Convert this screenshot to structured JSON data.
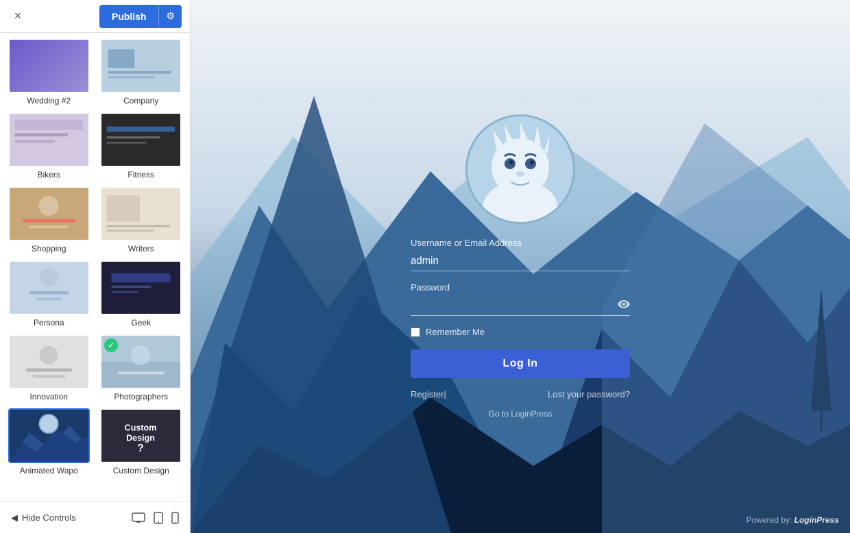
{
  "header": {
    "close_label": "×",
    "publish_label": "Publish",
    "settings_icon": "⚙"
  },
  "templates": [
    {
      "id": "wedding-id",
      "label": "Wedding #2",
      "theme": "wedding-id",
      "selected": false,
      "checked": false
    },
    {
      "id": "company",
      "label": "Company",
      "theme": "company",
      "selected": false,
      "checked": false
    },
    {
      "id": "bikers",
      "label": "Bikers",
      "theme": "bikers",
      "selected": false,
      "checked": false
    },
    {
      "id": "fitness",
      "label": "Fitness",
      "theme": "fitness",
      "selected": false,
      "checked": false
    },
    {
      "id": "shopping",
      "label": "Shopping",
      "theme": "shopping",
      "selected": false,
      "checked": false
    },
    {
      "id": "writers",
      "label": "Writers",
      "theme": "writers",
      "selected": false,
      "checked": false
    },
    {
      "id": "persona",
      "label": "Persona",
      "theme": "persona",
      "selected": false,
      "checked": false
    },
    {
      "id": "geek",
      "label": "Geek",
      "theme": "geek",
      "selected": false,
      "checked": false
    },
    {
      "id": "innovation",
      "label": "Innovation",
      "theme": "innovation",
      "selected": false,
      "checked": false
    },
    {
      "id": "photographers",
      "label": "Photographers",
      "theme": "photographers",
      "selected": false,
      "checked": true
    },
    {
      "id": "animated-wapo",
      "label": "Animated Wapo",
      "theme": "animated-wapo",
      "selected": true,
      "checked": false
    },
    {
      "id": "custom-design",
      "label": "Custom Design",
      "theme": "custom-design",
      "selected": false,
      "checked": false
    }
  ],
  "footer": {
    "hide_controls_label": "Hide Controls",
    "desktop_icon": "🖥",
    "tablet_icon": "📱",
    "mobile_icon": "📱"
  },
  "login": {
    "username_label": "Username or Email Address",
    "username_value": "admin",
    "password_label": "Password",
    "password_placeholder": "",
    "remember_label": "Remember Me",
    "login_button": "Log In",
    "register_link": "Register|",
    "lost_password_link": "Lost your password?",
    "go_loginpress": "Go to LoginPress",
    "powered_label": "Powered by:",
    "powered_brand": "LoginPress"
  }
}
